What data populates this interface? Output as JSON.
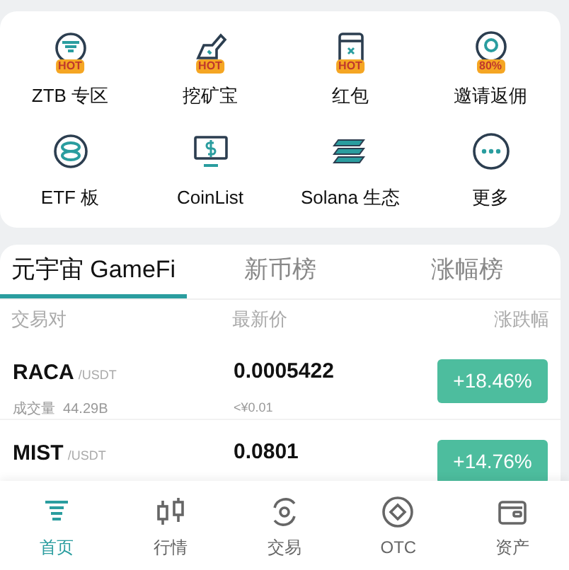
{
  "shortcuts": [
    {
      "label": "ZTB 专区",
      "badge": "HOT"
    },
    {
      "label": "挖矿宝",
      "badge": "HOT"
    },
    {
      "label": "红包",
      "badge": "HOT"
    },
    {
      "label": "邀请返佣",
      "badge": "80%"
    },
    {
      "label": "ETF 板"
    },
    {
      "label": "CoinList"
    },
    {
      "label": "Solana 生态"
    },
    {
      "label": "更多"
    }
  ],
  "tabs": [
    {
      "label": "元宇宙 GameFi",
      "selected": true
    },
    {
      "label": "新币榜",
      "selected": false
    },
    {
      "label": "涨幅榜",
      "selected": false
    }
  ],
  "table": {
    "columns": [
      "交易对",
      "最新价",
      "涨跌幅"
    ],
    "rows": [
      {
        "base": "RACA",
        "quote": "/USDT",
        "volume": "成交量  44.29B",
        "price": "0.0005422",
        "fiat": "<¥0.01",
        "change": "+18.46%"
      },
      {
        "base": "MIST",
        "quote": "/USDT",
        "price": "0.0801",
        "change": "+14.76%"
      }
    ]
  },
  "nav": [
    {
      "label": "首页",
      "selected": true
    },
    {
      "label": "行情",
      "selected": false
    },
    {
      "label": "交易",
      "selected": false
    },
    {
      "label": "OTC",
      "selected": false
    },
    {
      "label": "资产",
      "selected": false
    }
  ]
}
